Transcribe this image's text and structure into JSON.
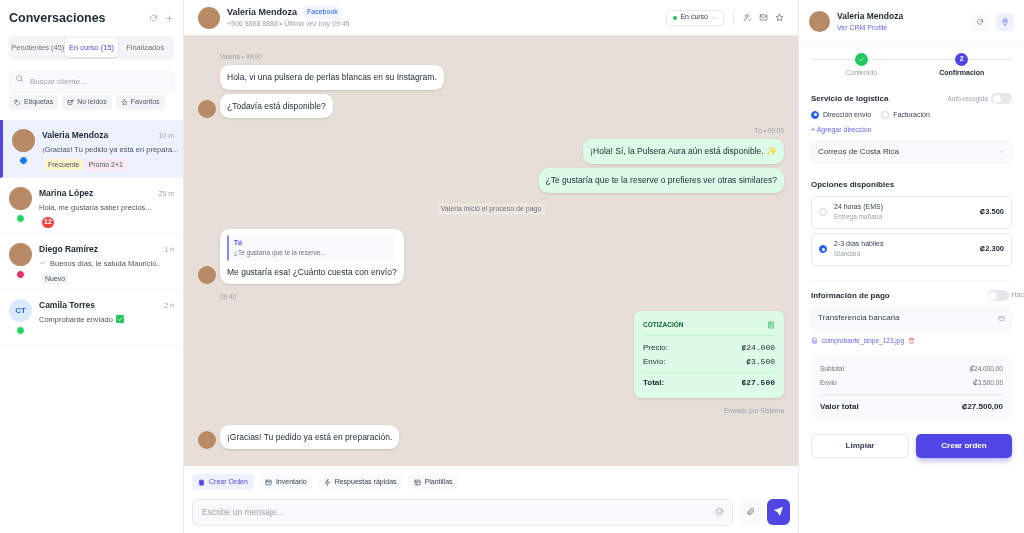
{
  "sidebar": {
    "title": "Conversaciones",
    "tabs": [
      {
        "label": "Pendientes (45)",
        "selected": false
      },
      {
        "label": "En curso (15)",
        "selected": true
      },
      {
        "label": "Finalizados",
        "selected": false
      }
    ],
    "search": {
      "placeholder": "Buscar cliente..."
    },
    "filters": [
      {
        "kind": "tag",
        "label": "Etiquetas"
      },
      {
        "kind": "unread",
        "label": "No leídos"
      },
      {
        "kind": "star",
        "label": "Favoritos"
      }
    ],
    "conversations": [
      {
        "kind": "photo",
        "name": "Valeria Mendoza",
        "time": "10 m",
        "preview": "¡Gracias! Tu pedido ya está en prepara...",
        "channel": {
          "kind": "facebook"
        },
        "selected": true,
        "tags": [
          {
            "label": "Frecuente",
            "color": "#fef3c7"
          },
          {
            "label": "Promo 2+1",
            "color": "#fce7f3"
          }
        ]
      },
      {
        "kind": "photo",
        "name": "Marina López",
        "time": "25 m",
        "preview": "Hola, me gustaría saber precios...",
        "channel": {
          "kind": "whatsapp"
        },
        "selected": false,
        "unread": "12"
      },
      {
        "kind": "photo",
        "name": "Diego Ramírez",
        "time": "1 h",
        "preview": "Buenos días, le saluda Mauricio.",
        "channel": {
          "kind": "instagram"
        },
        "selected": false,
        "sent": true,
        "tags": [
          {
            "label": "Nuevo",
            "color": "#f3f4f6"
          }
        ]
      },
      {
        "kind": "initials",
        "name": "Camila Torres",
        "time": "2 h",
        "preview": "Comprobante enviado",
        "channel": {
          "kind": "whatsapp"
        },
        "selected": false,
        "initials": "CT",
        "attachment_check": true
      }
    ]
  },
  "chat": {
    "name": "Valeria Mendoza",
    "channel_badge": "Facebook",
    "subtitle": "+506 8888 8888 • Última vez hoy 09:45",
    "status": "En curso",
    "messages": [
      {
        "kind": "in_meta",
        "text": "Valeria • 09:00"
      },
      {
        "kind": "in_text",
        "text": "Hola, vi una pulsera de perlas blancas en su Instagram.",
        "avatar": false
      },
      {
        "kind": "in_text",
        "text": "¿Todavía está disponible?",
        "avatar": true
      },
      {
        "kind": "out_meta",
        "text": "Tú • 09:05"
      },
      {
        "kind": "out_text",
        "text": "¡Hola! Sí, la Pulsera Aura aún está disponible. ✨"
      },
      {
        "kind": "out_text",
        "text": "¿Te gustaría que te la reserve o prefieres ver otras similares?"
      },
      {
        "kind": "system",
        "text": "Valeria inició el proceso de pago"
      },
      {
        "kind": "in_reply",
        "quote_author": "Tú",
        "quote_text": "¿Te gustaría que te la reserve...",
        "text": "Me gustaría esa! ¿Cuánto cuesta con envío?",
        "avatar": true
      },
      {
        "kind": "in_meta",
        "text": "09:40"
      },
      {
        "kind": "out_quotation",
        "title": "COTIZACIÓN",
        "rows": [
          {
            "label": "Precio:",
            "value": "₡24.000",
            "total": false
          },
          {
            "label": "Envío:",
            "value": "₡3.500",
            "total": false
          },
          {
            "label": "Total:",
            "value": "₡27.500",
            "total": true
          }
        ]
      },
      {
        "kind": "out_meta",
        "text": "Enviado por Sistema"
      },
      {
        "kind": "in_text",
        "text": "¡Gracias! Tu pedido ya está en preparación.",
        "avatar": true
      }
    ],
    "actions": [
      {
        "kind": "order",
        "label": "Crear Orden",
        "selected": true
      },
      {
        "kind": "inventory",
        "label": "Inventario",
        "selected": false
      },
      {
        "kind": "bolt",
        "label": "Respuestas rápidas",
        "selected": false
      },
      {
        "kind": "template",
        "label": "Plantillas",
        "selected": false
      }
    ],
    "composer": {
      "placeholder": "Escribe un mensaje..."
    }
  },
  "order_panel": {
    "name": "Valeria Mendoza",
    "profile_link": "Ver CRM Profile",
    "steps": [
      {
        "label": "Contenido",
        "done": true,
        "selected": false
      },
      {
        "label": "Confirmación",
        "number": "2",
        "done": false,
        "selected": true
      }
    ],
    "logistics": {
      "title": "Servicio de logística",
      "auto_label": "Auto-recogida",
      "auto_on": false,
      "address_types": [
        {
          "label": "Dirección envío",
          "selected": true
        },
        {
          "label": "Facturación",
          "selected": false
        }
      ],
      "add_address": "+ Agregar dirección",
      "carrier": "Correos de Costa Rica"
    },
    "options_title": "Opciones disponibles",
    "options": [
      {
        "title": "24 horas (EMS)",
        "subtitle": "Entrega mañana",
        "price": "₡3.500",
        "selected": false
      },
      {
        "title": "2-3 días hábiles",
        "subtitle": "Standard",
        "price": "₡2.300",
        "selected": true
      }
    ],
    "payment": {
      "title": "Información de pago",
      "toggle_on": false,
      "toggle_label": "Hac",
      "method": "Transferencia bancaria",
      "attachment": "comprobante_sinpe_123.jpg"
    },
    "summary": [
      {
        "label": "Subtotal",
        "value": "₡24.000,00",
        "total": false
      },
      {
        "label": "Envío",
        "value": "₡3.500,00",
        "total": false
      },
      {
        "label": "Valor total",
        "value": "₡27.500,00",
        "total": true
      }
    ],
    "buttons": [
      {
        "kind": "secondary",
        "label": "Limpiar"
      },
      {
        "kind": "primary",
        "label": "Crear orden"
      }
    ]
  }
}
